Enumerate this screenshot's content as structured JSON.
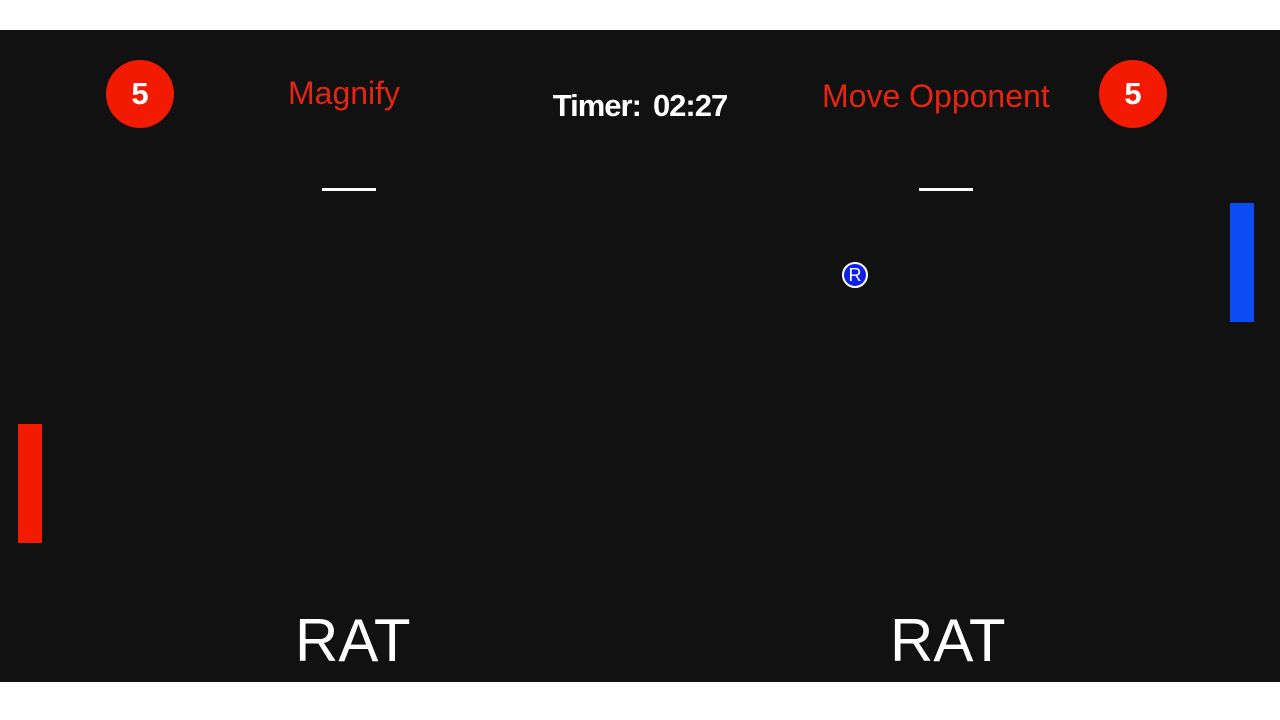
{
  "left_player": {
    "score": "5",
    "powerup": "Magnify",
    "powerup_status": "—",
    "name": "RAT",
    "color": "#f21a00"
  },
  "right_player": {
    "score": "5",
    "powerup": "Move Opponent",
    "powerup_status": "—",
    "name": "RAT",
    "color": "#0b4cf5"
  },
  "timer": {
    "label": "Timer:",
    "value": "02:27"
  },
  "ball": {
    "label": "R",
    "color": "#0d20e6"
  },
  "colors": {
    "background": "#111111",
    "score_badge": "#f21a00",
    "powerup_text": "#e52512"
  }
}
